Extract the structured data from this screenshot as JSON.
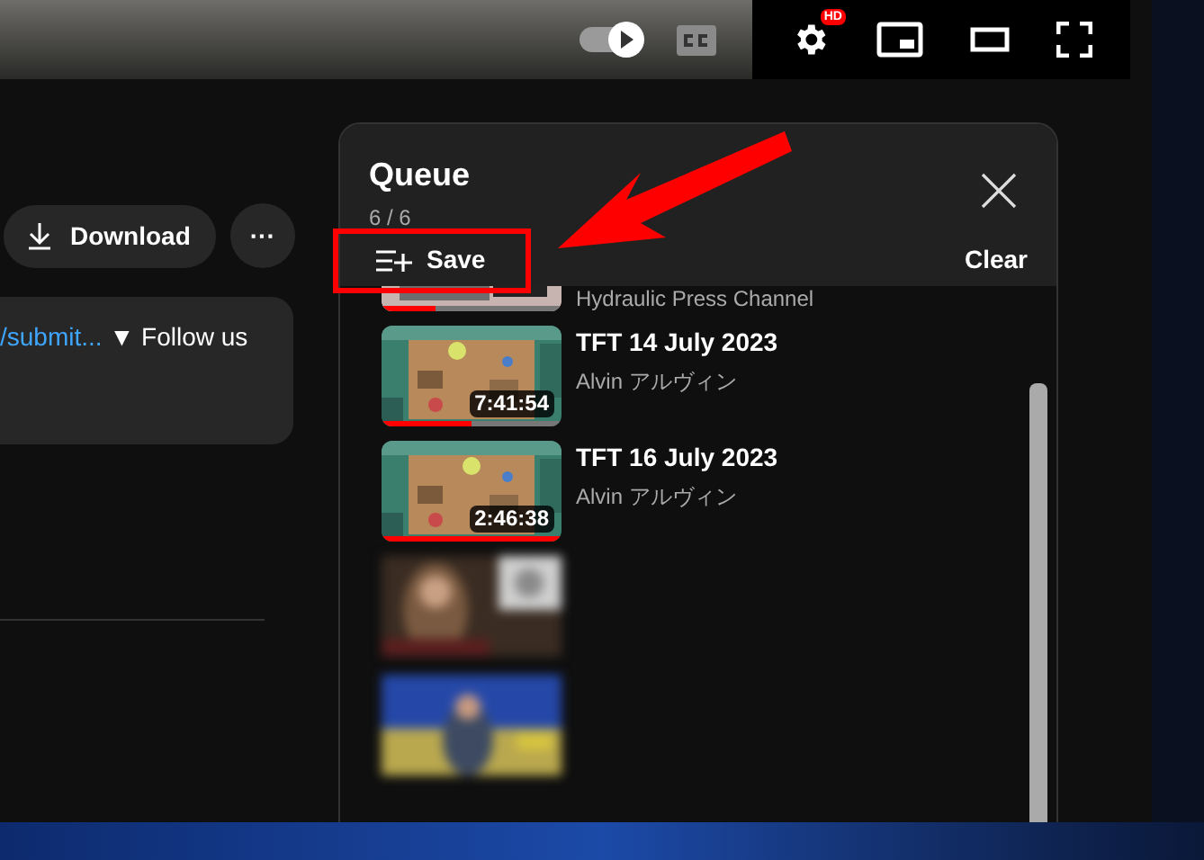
{
  "player": {
    "autoplay_on": true,
    "captions_on": false,
    "quality_badge": "HD"
  },
  "actions": {
    "download": "Download",
    "more": "···"
  },
  "description": {
    "link": "/submit...",
    "text": "▼ Follow us"
  },
  "queue": {
    "title": "Queue",
    "position": "6 / 6",
    "save": "Save",
    "clear": "Clear",
    "items": [
      {
        "kind": "partial",
        "channel": "Hydraulic Press Channel",
        "level": 0.3
      },
      {
        "kind": "video",
        "title": "TFT 14 July 2023",
        "channel": "Alvin アルヴィン",
        "duration": "7:41:54",
        "level": 0.5
      },
      {
        "kind": "video",
        "title": "TFT 16 July 2023",
        "channel": "Alvin アルヴィン",
        "duration": "2:46:38",
        "level": 1
      },
      {
        "kind": "blurred"
      },
      {
        "kind": "blurred"
      }
    ]
  }
}
